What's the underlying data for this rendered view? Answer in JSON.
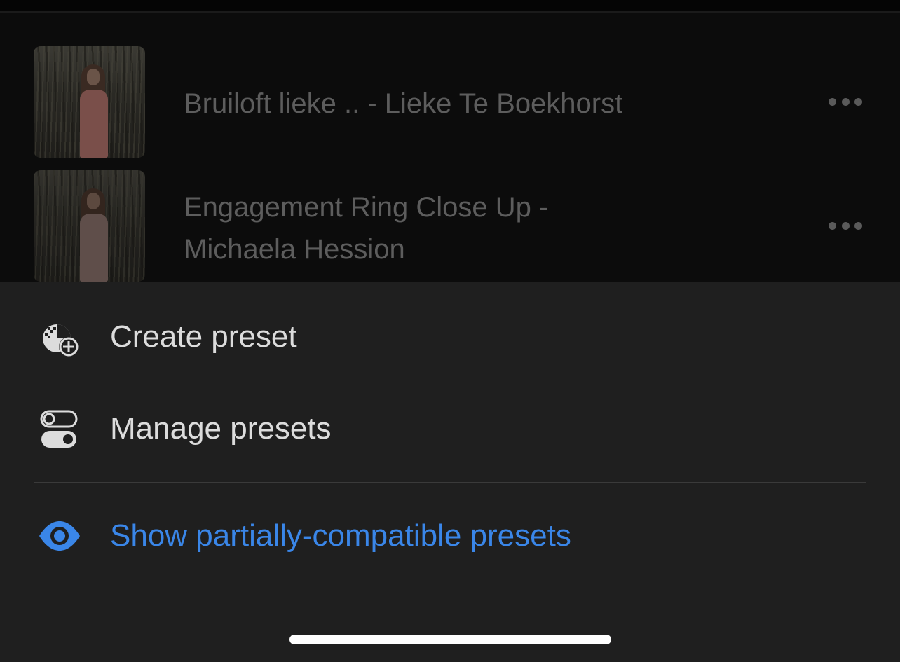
{
  "presets": [
    {
      "title_line1": "Bruiloft lieke .. - Lieke Te Boekhorst",
      "title_line2": ""
    },
    {
      "title_line1": "Engagement Ring Close Up -",
      "title_line2": "Michaela Hession"
    }
  ],
  "menu": {
    "create_preset": "Create preset",
    "manage_presets": "Manage presets",
    "show_partially_compatible": "Show partially-compatible presets"
  },
  "icons": {
    "create": "create-preset-icon",
    "manage": "toggle-switches-icon",
    "show": "eye-icon",
    "more": "more-options-icon"
  },
  "colors": {
    "accent": "#3a86e8",
    "sheet_bg": "#1f1f1f",
    "list_bg": "#0c0c0c",
    "menu_text": "#dcdcdc",
    "dimmed_text": "#5d5d5d"
  }
}
